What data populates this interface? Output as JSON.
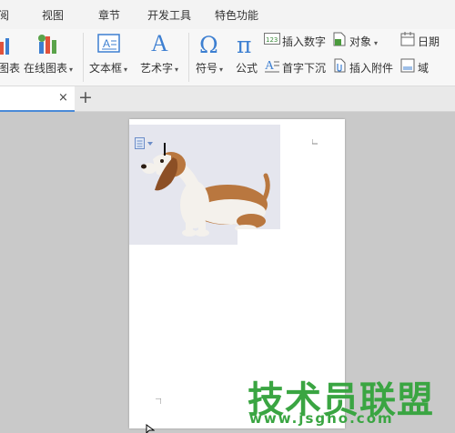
{
  "menu": {
    "tabs": [
      "阅",
      "视图",
      "章节",
      "开发工具",
      "特色功能"
    ]
  },
  "ribbon": {
    "chart_label": "图表",
    "online_chart_label": "在线图表",
    "textbox_label": "文本框",
    "wordart_label": "艺术字",
    "symbol_label": "符号",
    "formula_label": "公式",
    "insert_number_label": "插入数字",
    "object_label": "对象",
    "date_label": "日期",
    "drop_cap_label": "首字下沉",
    "insert_attachment_label": "插入附件",
    "field_label": "域",
    "number_icon_text": "123",
    "caret": "▾"
  },
  "tabbar": {
    "close_glyph": "×",
    "new_tab_glyph": "+"
  },
  "watermark": {
    "title": "技术员联盟",
    "url": "www.jsgho.com"
  },
  "colors": {
    "accent_blue": "#4a8ad8",
    "watermark_green": "#3aa542"
  }
}
